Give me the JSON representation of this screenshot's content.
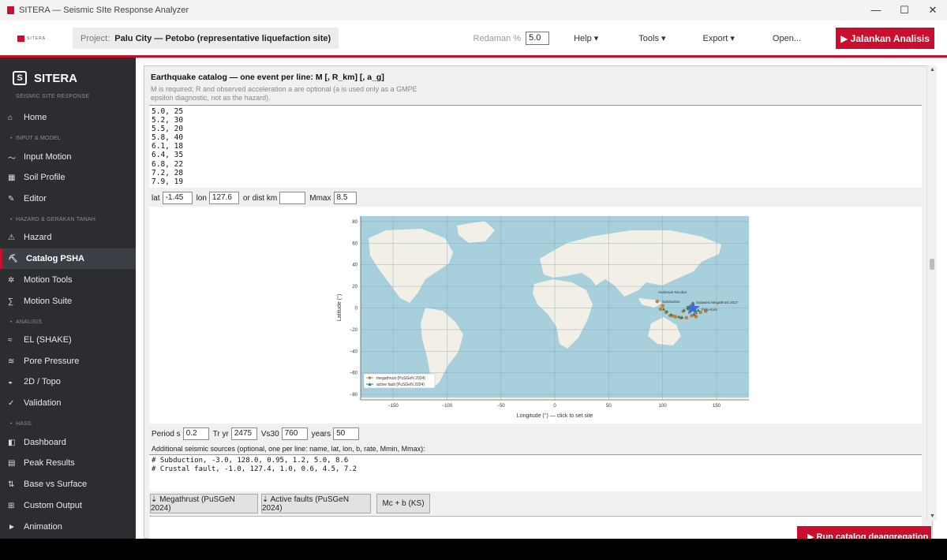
{
  "window": {
    "title": "SITERA — Seismic SIte Response Analyzer",
    "minimize": "—",
    "maximize": "☐",
    "close": "✕"
  },
  "header": {
    "logo_text": "SITERA",
    "project_label": "Project:",
    "project_name": "Palu City — Petobo (representative liquefaction site)",
    "damping_label": "Redaman %",
    "damping_value": "5.0",
    "menus": [
      "Help ▾",
      "Tools ▾",
      "Export ▾",
      "Open..."
    ],
    "run_label": "▶  Jalankan Analisis"
  },
  "sidebar": {
    "brand": "SITERA",
    "brand_icon": "S",
    "subtitle": "SEISMIC SITE RESPONSE",
    "sections": [
      "INPUT & MODEL",
      "HAZARD & GERAKAN TANAH",
      "ANALISIS",
      "HASIL"
    ],
    "items": [
      {
        "label": "Home",
        "icon": "⌂"
      },
      {
        "label": "Input Motion",
        "icon": "〜"
      },
      {
        "label": "Soil Profile",
        "icon": "▦"
      },
      {
        "label": "Editor",
        "icon": "✎"
      },
      {
        "label": "Hazard",
        "icon": "⚠"
      },
      {
        "label": "Catalog PSHA",
        "icon": "⛏"
      },
      {
        "label": "Motion Tools",
        "icon": "✲"
      },
      {
        "label": "Motion Suite",
        "icon": "∑"
      },
      {
        "label": "EL (SHAKE)",
        "icon": "≈"
      },
      {
        "label": "Pore Pressure",
        "icon": "≋"
      },
      {
        "label": "2D / Topo",
        "icon": "◒"
      },
      {
        "label": "Validation",
        "icon": "✓"
      },
      {
        "label": "Dashboard",
        "icon": "◧"
      },
      {
        "label": "Peak Results",
        "icon": "▤"
      },
      {
        "label": "Base vs Surface",
        "icon": "⇅"
      },
      {
        "label": "Custom Output",
        "icon": "⊞"
      },
      {
        "label": "Animation",
        "icon": "►"
      }
    ],
    "active_index": 5
  },
  "catalog": {
    "heading": "Earthquake catalog — one event per line:  M  [, R_km] [, a_g]",
    "hint": "M is required; R and observed acceleration a are optional (a is used only as a GMPE epsilon diagnostic, not as the hazard).",
    "text": "5.0, 25\n5.2, 30\n5.5, 20\n5.8, 40\n6.1, 18\n6.4, 35\n6.8, 22\n7.2, 28\n7.9, 19"
  },
  "site": {
    "lat_label": "lat",
    "lat_value": "-1.45",
    "lon_label": "lon",
    "lon_value": "127.6",
    "dist_label": "or dist km",
    "dist_value": "",
    "mmax_label": "Mmax",
    "mmax_value": "8.5"
  },
  "map": {
    "ylabel": "Latitude (°)",
    "xlabel": "Longitude (°)  —  click to set site",
    "xticks": [
      "−150",
      "−100",
      "−50",
      "0",
      "50",
      "100",
      "150"
    ],
    "yticks": [
      "80",
      "60",
      "40",
      "20",
      "0",
      "−20",
      "−40",
      "−60",
      "−80"
    ],
    "legend": [
      {
        "label": "megathrust (PuSGeN 2024)",
        "color": "#c8843a"
      },
      {
        "label": "active fault (PuSGeN 2024)",
        "color": "#2e7d4f"
      }
    ],
    "annotations": [
      "Andaman-Nicobar",
      "Subduction",
      "Sulawesi Megathrust 2017",
      "Palu-Koro"
    ],
    "ocean_color": "#a8d0dc",
    "land_color": "#f2efe6",
    "site_marker_color": "#3b6fd4"
  },
  "params": {
    "period_label": "Period s",
    "period_value": "0.2",
    "tr_label": "Tr yr",
    "tr_value": "2475",
    "vs30_label": "Vs30",
    "vs30_value": "760",
    "years_label": "years",
    "years_value": "50"
  },
  "sources": {
    "label": "Additional seismic sources (optional, one per line: name, lat, lon, b, rate, Mmin, Mmax):",
    "text": "# Subduction, -3.0, 128.0, 0.95, 1.2, 5.0, 8.6\n# Crustal fault, -1.0, 127.4, 1.0, 0.6, 4.5, 7.2"
  },
  "buttons": {
    "megathrust": "⇣ Megathrust (PuSGeN 2024)",
    "faults": "⇣ Active faults (PuSGeN 2024)",
    "mc": "Mc + b (KS)",
    "run_catalog": "▶  Run catalog deaggregation"
  }
}
